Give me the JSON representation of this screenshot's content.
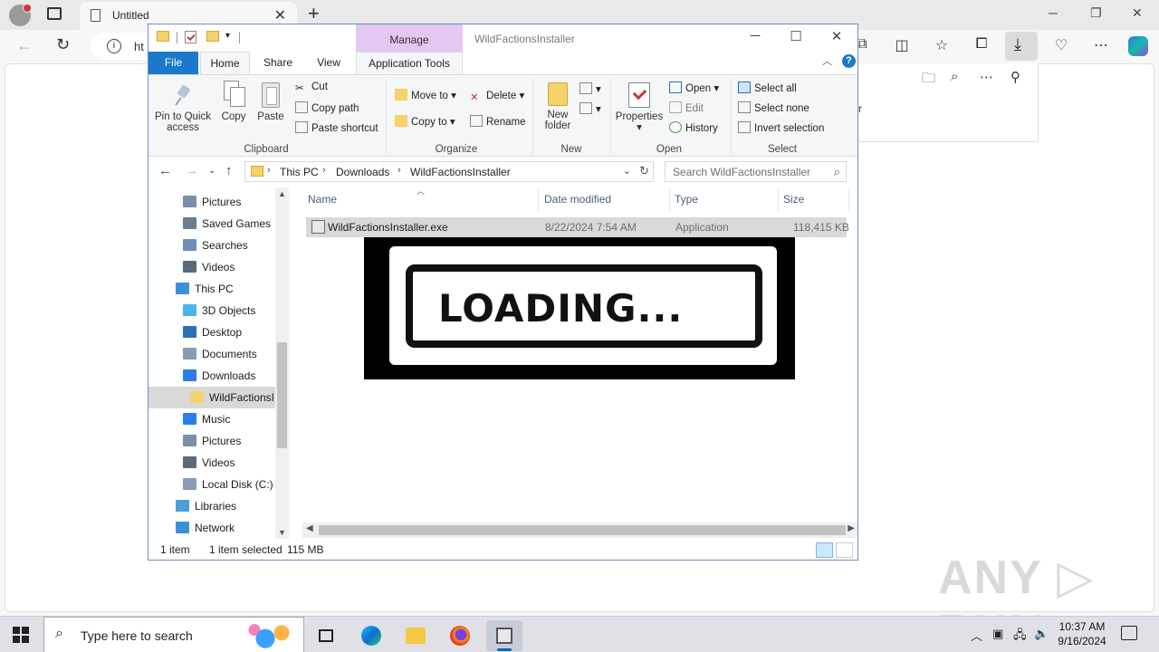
{
  "browser": {
    "tab_title": "Untitled",
    "url_prefix": "ht",
    "panel_text": "r"
  },
  "explorer": {
    "window_title": "WildFactionsInstaller",
    "manage_label": "Manage",
    "ribbon_tabs": [
      "File",
      "Home",
      "Share",
      "View",
      "Application Tools"
    ],
    "clipboard": {
      "pin": "Pin to Quick access",
      "copy": "Copy",
      "paste": "Paste",
      "cut": "Cut",
      "copy_path": "Copy path",
      "paste_shortcut": "Paste shortcut",
      "label": "Clipboard"
    },
    "organize": {
      "move_to": "Move to",
      "copy_to": "Copy to",
      "delete": "Delete",
      "rename": "Rename",
      "label": "Organize"
    },
    "new": {
      "new_folder": "New folder",
      "label": "New"
    },
    "open": {
      "properties": "Properties",
      "open": "Open",
      "edit": "Edit",
      "history": "History",
      "label": "Open"
    },
    "select": {
      "select_all": "Select all",
      "select_none": "Select none",
      "invert": "Invert selection",
      "label": "Select"
    },
    "breadcrumb": [
      "This PC",
      "Downloads",
      "WildFactionsInstaller"
    ],
    "search_placeholder": "Search WildFactionsInstaller",
    "nav_items": [
      {
        "label": "Pictures",
        "icon": "pictures-icon"
      },
      {
        "label": "Saved Games",
        "icon": "saved-games-icon"
      },
      {
        "label": "Searches",
        "icon": "searches-icon"
      },
      {
        "label": "Videos",
        "icon": "videos-icon"
      },
      {
        "label": "This PC",
        "icon": "this-pc-icon"
      },
      {
        "label": "3D Objects",
        "icon": "3d-objects-icon"
      },
      {
        "label": "Desktop",
        "icon": "desktop-icon"
      },
      {
        "label": "Documents",
        "icon": "documents-icon"
      },
      {
        "label": "Downloads",
        "icon": "downloads-icon"
      },
      {
        "label": "WildFactionsI",
        "icon": "folder-icon"
      },
      {
        "label": "Music",
        "icon": "music-icon"
      },
      {
        "label": "Pictures",
        "icon": "pictures-icon"
      },
      {
        "label": "Videos",
        "icon": "videos-icon"
      },
      {
        "label": "Local Disk (C:)",
        "icon": "disk-icon"
      },
      {
        "label": "Libraries",
        "icon": "libraries-icon"
      },
      {
        "label": "Network",
        "icon": "network-icon"
      }
    ],
    "columns": [
      "Name",
      "Date modified",
      "Type",
      "Size"
    ],
    "files": [
      {
        "name": "WildFactionsInstaller.exe",
        "date": "8/22/2024 7:54 AM",
        "type": "Application",
        "size": "118,415 KB"
      }
    ],
    "status": {
      "count": "1 item",
      "selected": "1 item selected",
      "size": "115 MB"
    }
  },
  "overlay": {
    "loading_text": "LOADING..."
  },
  "taskbar": {
    "search_placeholder": "Type here to search",
    "time": "10:37 AM",
    "date": "9/16/2024"
  },
  "watermark": "ANY RUN",
  "colors": {
    "file_tab": "#1979ca",
    "manage_tab": "#e3c8f2",
    "selection": "#d9d9d9",
    "accent": "#0067c0"
  }
}
